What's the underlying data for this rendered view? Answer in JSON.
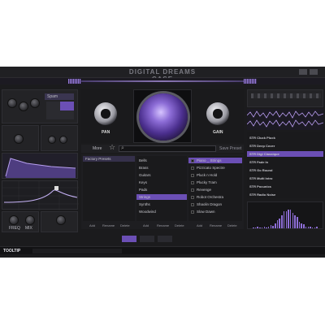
{
  "app": {
    "title": "DIGITAL DREAMS CASE"
  },
  "sections": {
    "knob_panel_dropdown": "Spam",
    "pan_label": "PAN",
    "gain_label": "GAIN",
    "freq_label": "FREQ",
    "mix_label": "MIX"
  },
  "browser": {
    "more_label": "More",
    "save_preset_label": "Save Preset",
    "search_placeholder": "",
    "banks": [
      "Factory Presets"
    ],
    "categories": [
      "Bells",
      "Brass",
      "Guitars",
      "Keys",
      "Pads",
      "Strings",
      "Synths",
      "Woodwind"
    ],
    "selected_category": "Strings",
    "presets": [
      "Piano _ Strings",
      "Pizzicato Spectre",
      "Pluck n Hold",
      "Plucky Tram",
      "Revenge",
      "Robot Orchestra",
      "Shaolin Dragon",
      "Slow Dawn"
    ],
    "selected_preset": "Piano _ Strings",
    "actions": {
      "bank": [
        "Add",
        "Rename",
        "Delete"
      ],
      "category": [
        "Add",
        "Rename",
        "Delete"
      ],
      "preset": [
        "Add",
        "Rename",
        "Delete"
      ]
    }
  },
  "sample_list": {
    "items": [
      "STR Cluck Pluck",
      "STR Deep Cover",
      "STR Digi Classique",
      "STR Fade In",
      "STR Go Round",
      "STR Multi Intro",
      "STR Pocunics",
      "STR Radio Noise"
    ],
    "selected": "STR Digi Classique"
  },
  "footer": {
    "tooltip_label": "TOOLTIP"
  },
  "colors": {
    "accent": "#8f6fd8",
    "background": "#1b1b1d",
    "panel": "#232326",
    "highlight": "#6b4fb5"
  }
}
